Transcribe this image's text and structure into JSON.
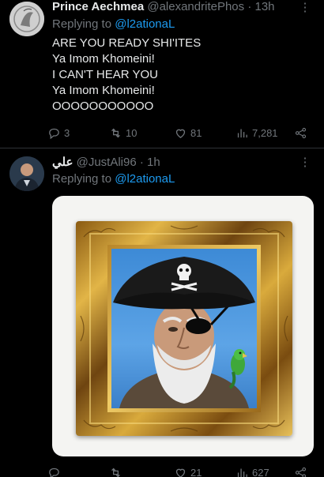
{
  "tweets": [
    {
      "name": "Prince Aechmea",
      "handle": "@alexandritePhos",
      "time": "· 13h",
      "reply_prefix": "Replying to ",
      "reply_to": "@l2ationaL",
      "lines": [
        "ARE YOU READY SHI'ITES",
        "Ya Imom Khomeini!",
        "I CAN'T HEAR YOU",
        "Ya Imom Khomeini!",
        "OOOOOOOOOOO"
      ],
      "replies": "3",
      "retweets": "10",
      "likes": "81",
      "views": "7,281"
    },
    {
      "name": "علي",
      "handle": "@JustAli96",
      "time": "· 1h",
      "reply_prefix": "Replying to ",
      "reply_to": "@l2ationaL",
      "replies": "",
      "retweets": "",
      "likes": "21",
      "views": "627"
    }
  ],
  "colors": {
    "background": "#000000",
    "text": "#e7e9ea",
    "muted": "#71767b",
    "link": "#1d9bf0"
  },
  "icons": [
    "more-icon",
    "reply-icon",
    "retweet-icon",
    "like-icon",
    "views-icon",
    "share-icon"
  ]
}
